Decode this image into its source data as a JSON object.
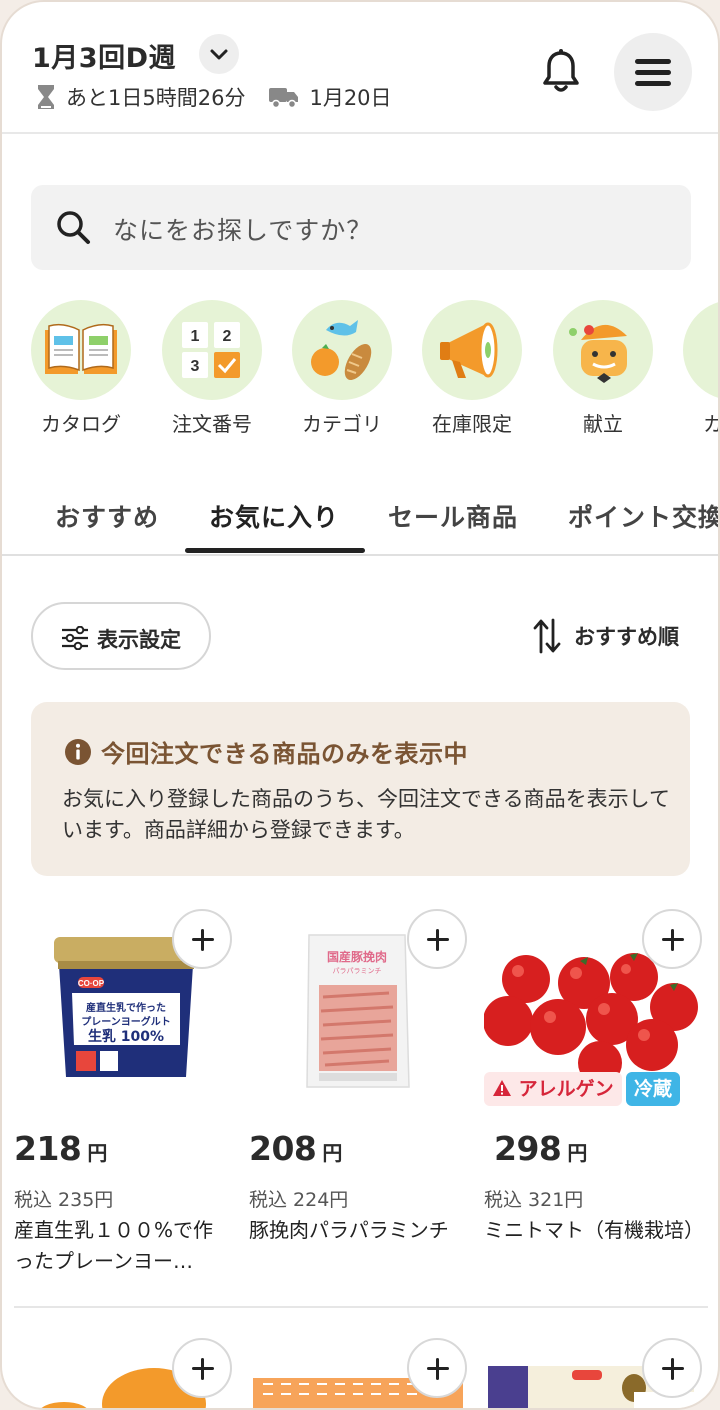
{
  "header": {
    "week_title": "1月3回D週",
    "deadline_text": "あと1日5時間26分",
    "delivery_text": "1月20日"
  },
  "search": {
    "placeholder": "なにをお探しですか？"
  },
  "categories": [
    {
      "label": "カタログ",
      "icon": "open-book-icon"
    },
    {
      "label": "注文番号",
      "icon": "order-number-icon"
    },
    {
      "label": "カテゴリ",
      "icon": "food-category-icon"
    },
    {
      "label": "在庫限定",
      "icon": "megaphone-icon"
    },
    {
      "label": "献立",
      "icon": "menu-pot-icon"
    },
    {
      "label": "カ",
      "icon": "partial-icon"
    }
  ],
  "tabs": [
    {
      "label": "おすすめ",
      "active": false
    },
    {
      "label": "お気に入り",
      "active": true
    },
    {
      "label": "セール商品",
      "active": false
    },
    {
      "label": "ポイント交換",
      "active": false
    }
  ],
  "filter": {
    "display_settings": "表示設定",
    "sort_label": "おすすめ順"
  },
  "info": {
    "title": "今回注文できる商品のみを表示中",
    "body": "お気に入り登録した商品のうち、今回注文できる商品を表示しています。商品詳細から登録できます。"
  },
  "products": [
    {
      "price": "218",
      "yen": "円",
      "tax": "税込 235円",
      "name": "産直生乳１００%で作ったプレーンヨー…",
      "brand_label": "CO·OP",
      "pack_text": "産直生乳で作ったプレーンヨーグルト 生乳100%"
    },
    {
      "price": "208",
      "yen": "円",
      "tax": "税込 224円",
      "name": "豚挽肉パラパラミンチ",
      "pack_text": "国産豚挽肉 パラパラミンチ"
    },
    {
      "price": "298",
      "yen": "円",
      "tax": "税込 321円",
      "name": "ミニトマト（有機栽培）",
      "tags": [
        "アレルゲン",
        "冷蔵"
      ]
    }
  ],
  "colors": {
    "accent": "#7a5433",
    "info_bg": "#f3ece4",
    "category_bg": "#e6f3d6",
    "allergen": "#d6263a",
    "chilled": "#3fb5e6"
  }
}
